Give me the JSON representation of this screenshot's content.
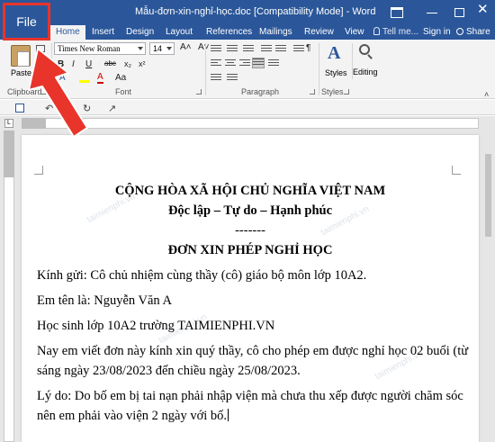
{
  "window": {
    "title": "Mẫu-đơn-xin-nghỉ-học.doc [Compatibility Mode] - Word",
    "controls": [
      "restore",
      "minimize",
      "maximize",
      "close"
    ]
  },
  "ribbon_tabs": [
    {
      "label": "Home",
      "active": true
    },
    {
      "label": "Insert"
    },
    {
      "label": "Design"
    },
    {
      "label": "Layout"
    },
    {
      "label": "References"
    },
    {
      "label": "Mailings"
    },
    {
      "label": "Review"
    },
    {
      "label": "View"
    }
  ],
  "tell_me": "Tell me...",
  "sign_in": "Sign in",
  "share": "Share",
  "file_button": "File",
  "clipboard": {
    "paste_label": "Paste",
    "group_label": "Clipboard"
  },
  "font": {
    "name": "Times New Roman",
    "size": "14",
    "group_label": "Font",
    "buttons": [
      "B",
      "I",
      "U",
      "abc",
      "x₂",
      "x²",
      "A",
      "Aa",
      "A"
    ]
  },
  "paragraph": {
    "group_label": "Paragraph"
  },
  "styles": {
    "label": "Styles",
    "group_label": "Styles"
  },
  "editing": {
    "label": "Editing"
  },
  "document": {
    "header_line1": "CỘNG HÒA XÃ HỘI CHỦ NGHĨA VIỆT NAM",
    "header_line2": "Độc lập – Tự do – Hạnh phúc",
    "divider": "-------",
    "doc_title": "ĐƠN XIN PHÉP NGHỈ HỌC",
    "lines": [
      "Kính gửi: Cô chủ nhiệm cùng thầy (cô) giáo bộ môn lớp 10A2.",
      "Em tên là: Nguyễn Văn A",
      "Học sinh lớp 10A2 trường TAIMIENPHI.VN",
      "Nay em viết đơn này kính xin quý thầy, cô cho phép em được nghỉ học 02 buổi (từ",
      "sáng ngày 23/08/2023 đến chiều ngày 25/08/2023.",
      "Lý do: Do bố em bị tai nạn phải nhập viện mà chưa thu xếp được người chăm sóc",
      "nên em phải vào viện 2 ngày với bố."
    ],
    "watermark": "taimienphi.vn"
  },
  "colors": {
    "word_blue": "#2b579a",
    "highlight_red": "#e8342a"
  }
}
